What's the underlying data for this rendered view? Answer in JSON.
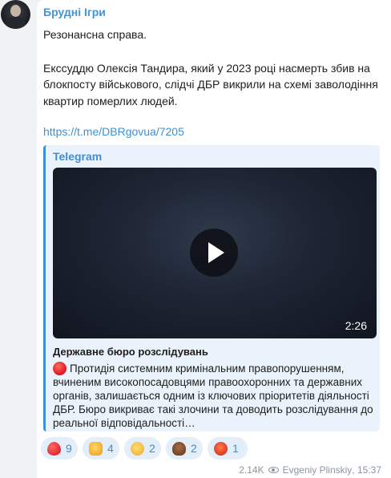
{
  "channel": {
    "name": "Брудні Ігри"
  },
  "message": {
    "paragraphs": [
      "Резонансна справа.",
      "Екссуддю Олексія Тандира, який у 2023 році насмерть збив на блокпосту військового, слідчі ДБР викрили на схемі заволодіння квартир померлих людей."
    ],
    "link": "https://t.me/DBRgovua/7205"
  },
  "preview": {
    "site_name": "Telegram",
    "video_duration": "2:26",
    "title": "Державне бюро розслідувань",
    "description": "Протидія системним кримінальним правопорушенням, вчиненим високопосадовцями правоохоронних та державних органів, залишається одним із ключових пріоритетів діяльності ДБР. Бюро викриває такі злочини та доводить розслідування до реальної відповідальності…"
  },
  "reactions": [
    {
      "emoji": "red-heart",
      "count": "9"
    },
    {
      "emoji": "thumbs-up",
      "count": "4"
    },
    {
      "emoji": "grinning-face",
      "count": "2"
    },
    {
      "emoji": "pile-of-poo",
      "count": "2"
    },
    {
      "emoji": "face-with-symbols-on-mouth",
      "count": "1"
    }
  ],
  "meta": {
    "views": "2.14K",
    "author": "Evgeniy Plinskiy",
    "time": "15:37"
  }
}
